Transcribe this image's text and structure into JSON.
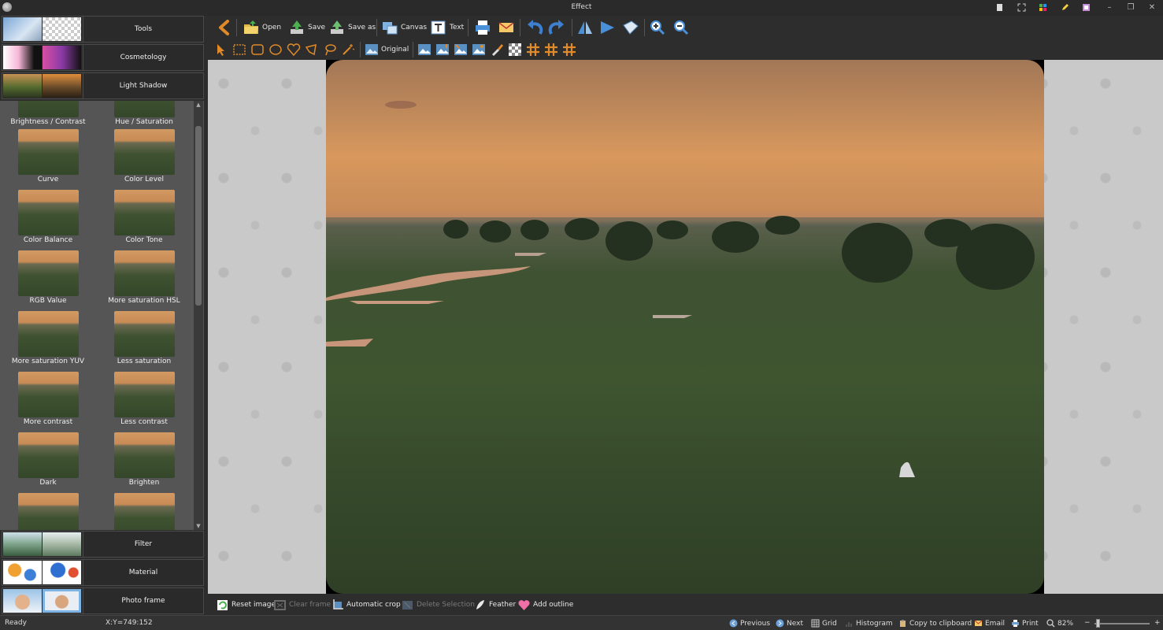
{
  "window": {
    "title": "Effect"
  },
  "categories": [
    {
      "label": "Tools"
    },
    {
      "label": "Cosmetology"
    },
    {
      "label": "Light Shadow"
    },
    {
      "label": "Filter"
    },
    {
      "label": "Material"
    },
    {
      "label": "Photo frame"
    }
  ],
  "effects": [
    {
      "label": "Brightness / Contrast"
    },
    {
      "label": "Hue / Saturation"
    },
    {
      "label": "Curve"
    },
    {
      "label": "Color Level"
    },
    {
      "label": "Color Balance"
    },
    {
      "label": "Color Tone"
    },
    {
      "label": "RGB Value"
    },
    {
      "label": "More saturation HSL"
    },
    {
      "label": "More saturation YUV"
    },
    {
      "label": "Less saturation"
    },
    {
      "label": "More contrast"
    },
    {
      "label": "Less contrast"
    },
    {
      "label": "Dark"
    },
    {
      "label": "Brighten"
    }
  ],
  "toolbar": {
    "open": "Open",
    "save": "Save",
    "save_as": "Save as",
    "canvas": "Canvas",
    "text": "Text",
    "original": "Original"
  },
  "bottombar": {
    "reset_image": "Reset image",
    "clear_frame": "Clear frame",
    "automatic_crop": "Automatic crop",
    "delete_selection": "Delete Selection",
    "feather": "Feather",
    "add_outline": "Add outline"
  },
  "status": {
    "state": "Ready",
    "coords": "X:Y=749:152",
    "previous": "Previous",
    "next": "Next",
    "grid": "Grid",
    "histogram": "Histogram",
    "copy": "Copy to clipboard",
    "email": "Email",
    "print": "Print",
    "zoom": "82%",
    "zoom_minus": "−",
    "zoom_plus": "+"
  },
  "colors": {
    "accent_orange": "#e08a2a",
    "panel_bg": "#2d2d2d",
    "effects_bg": "#555555"
  }
}
